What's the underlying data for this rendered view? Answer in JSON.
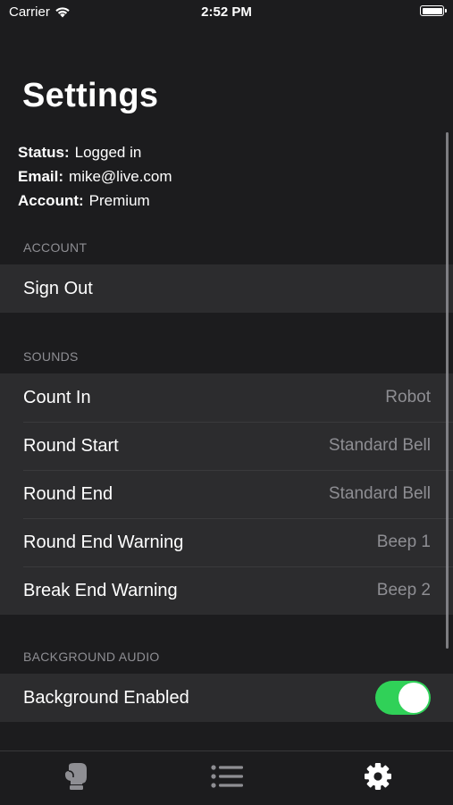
{
  "status_bar": {
    "carrier": "Carrier",
    "time": "2:52 PM",
    "battery_level": 1.0
  },
  "page": {
    "title": "Settings"
  },
  "user_info": {
    "status_label": "Status:",
    "status_value": "Logged in",
    "email_label": "Email:",
    "email_value": "mike@live.com",
    "account_label": "Account:",
    "account_value": "Premium"
  },
  "sections": {
    "account": {
      "header": "ACCOUNT",
      "sign_out": "Sign Out"
    },
    "sounds": {
      "header": "SOUNDS",
      "rows": [
        {
          "label": "Count In",
          "value": "Robot"
        },
        {
          "label": "Round Start",
          "value": "Standard Bell"
        },
        {
          "label": "Round End",
          "value": "Standard Bell"
        },
        {
          "label": "Round End Warning",
          "value": "Beep 1"
        },
        {
          "label": "Break End Warning",
          "value": "Beep 2"
        }
      ]
    },
    "background_audio": {
      "header": "BACKGROUND AUDIO",
      "label": "Background Enabled",
      "enabled": true
    }
  },
  "tab_bar": {
    "tabs": [
      {
        "icon": "boxing-glove-icon",
        "active": false
      },
      {
        "icon": "list-icon",
        "active": false
      },
      {
        "icon": "gear-icon",
        "active": true
      }
    ]
  },
  "colors": {
    "toggle_on": "#30d158",
    "background": "#1c1c1e",
    "cell": "#2c2c2e",
    "secondary_text": "#8e8e93"
  }
}
